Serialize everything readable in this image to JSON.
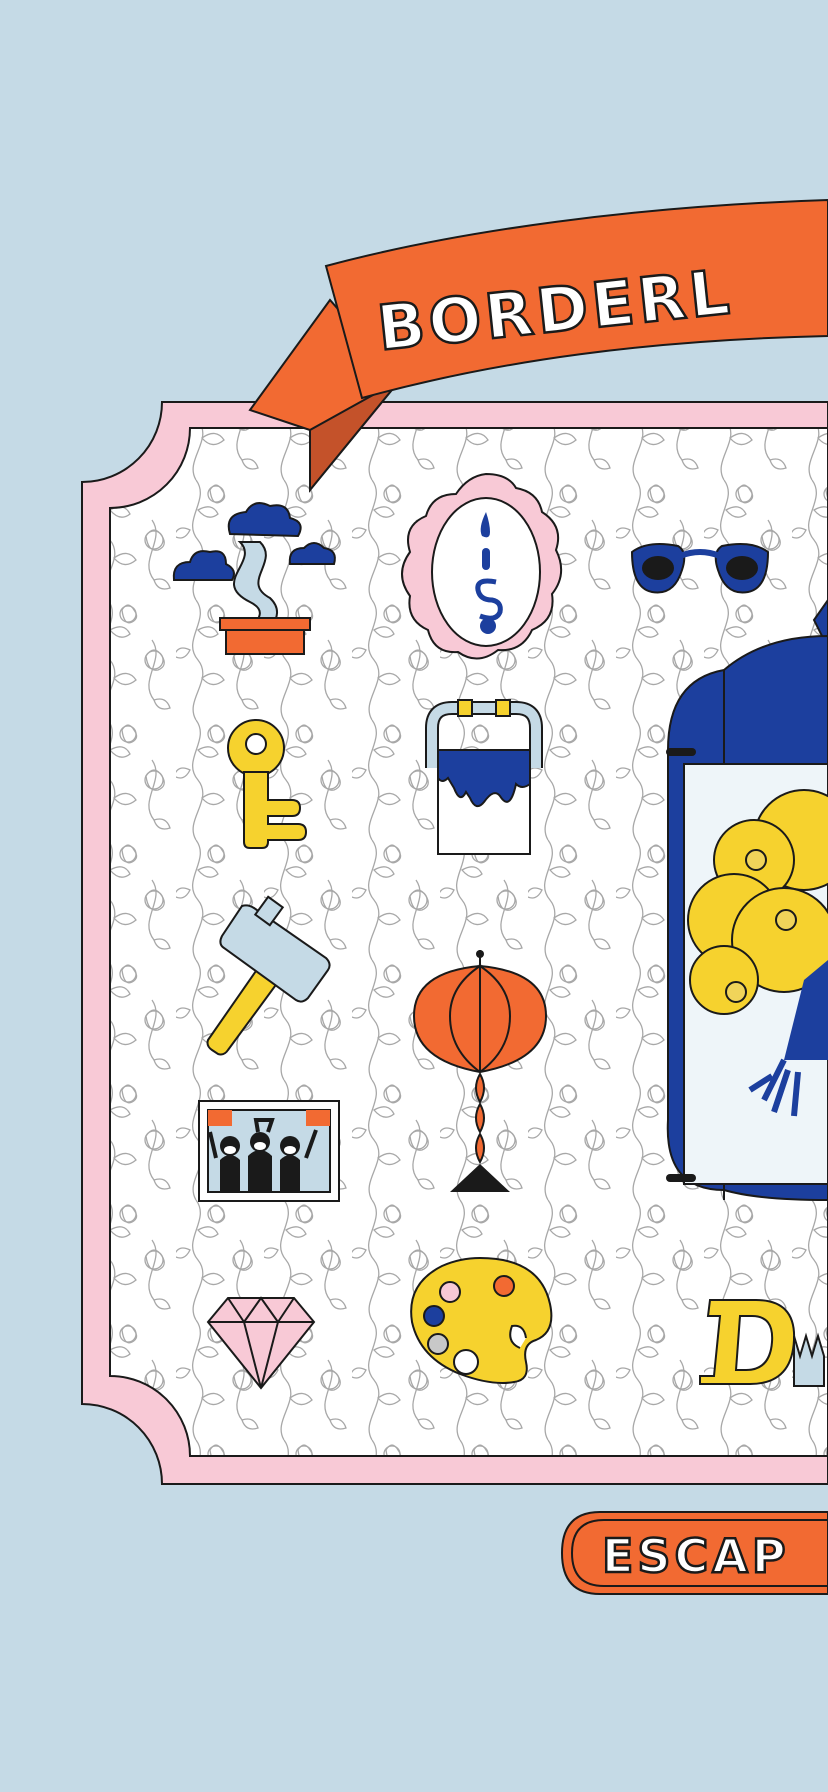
{
  "title_banner": {
    "text": "BORDERL"
  },
  "bottom_button": {
    "text": "ESCAP"
  },
  "colors": {
    "background": "#c5dae6",
    "frame_pink": "#f8c9d6",
    "accent_orange": "#f26a32",
    "accent_blue": "#1c3f9e",
    "accent_yellow": "#f6d22e",
    "pale_blue": "#c5dae6"
  },
  "items": [
    {
      "name": "bonsai-tree",
      "icon": "bonsai-icon"
    },
    {
      "name": "mirror",
      "icon": "mirror-icon"
    },
    {
      "name": "sunglasses",
      "icon": "sunglasses-icon"
    },
    {
      "name": "key",
      "icon": "key-icon"
    },
    {
      "name": "paint-bucket",
      "icon": "paint-bucket-icon"
    },
    {
      "name": "hammer",
      "icon": "hammer-icon"
    },
    {
      "name": "lantern",
      "icon": "lantern-icon"
    },
    {
      "name": "photo",
      "icon": "photo-icon"
    },
    {
      "name": "diamond",
      "icon": "diamond-icon"
    },
    {
      "name": "palette",
      "icon": "palette-icon"
    },
    {
      "name": "letter-d",
      "icon": "letter-d-icon"
    },
    {
      "name": "scroll-case",
      "icon": "scroll-case-icon"
    }
  ]
}
